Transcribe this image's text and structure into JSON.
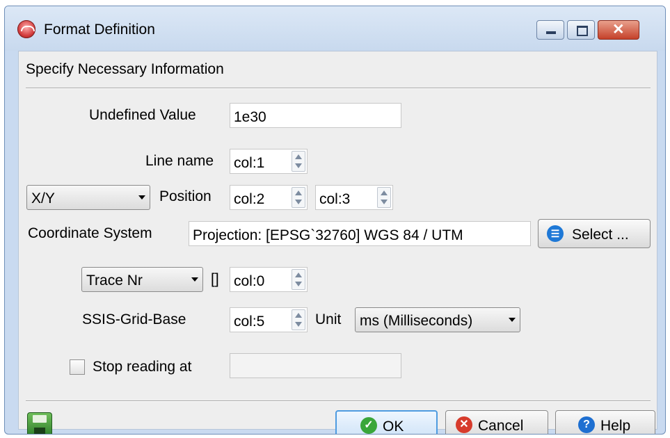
{
  "window": {
    "title": "Format Definition",
    "close_glyph": "✕"
  },
  "header": {
    "instruction": "Specify Necessary Information"
  },
  "form": {
    "undefined_value": {
      "label": "Undefined Value",
      "value": "1e30"
    },
    "line_name": {
      "label": "Line name",
      "value": "col:1"
    },
    "position": {
      "type_selected": "X/Y",
      "label": "Position",
      "x_value": "col:2",
      "y_value": "col:3"
    },
    "coordinate_system": {
      "label": "Coordinate System",
      "value": "Projection: [EPSG`32760] WGS 84 / UTM",
      "select_label": "Select ..."
    },
    "trace": {
      "type_selected": "Trace Nr",
      "bracket": "[]",
      "value": "col:0"
    },
    "ssis_grid_base": {
      "label": "SSIS-Grid-Base",
      "value": "col:5",
      "unit_label": "Unit",
      "unit_selected": "ms (Milliseconds)"
    },
    "stop_reading": {
      "label": "Stop reading at",
      "checked": false,
      "value": ""
    }
  },
  "footer": {
    "ok_label": "OK",
    "cancel_label": "Cancel",
    "help_label": "Help",
    "help_glyph": "?",
    "ok_glyph": "✓",
    "cancel_glyph": "✕",
    "select_glyph": "☰"
  },
  "colors": {
    "ok_icon": "#3aa63a",
    "cancel_icon": "#d73b2c",
    "help_icon": "#1e6fd1",
    "select_icon": "#1e78d6"
  }
}
